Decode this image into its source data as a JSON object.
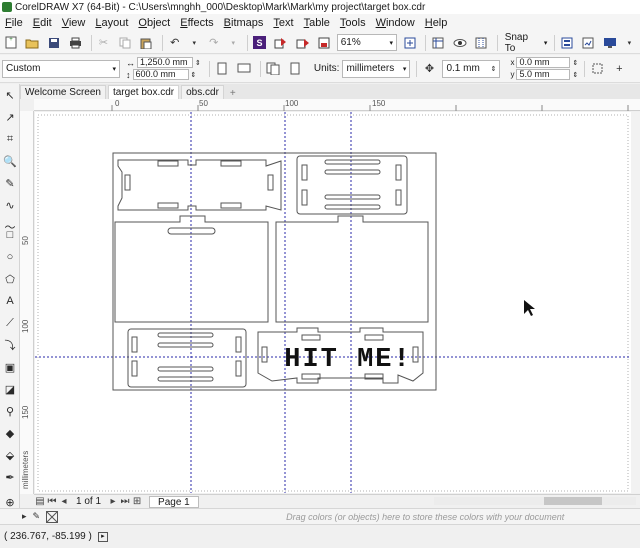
{
  "window": {
    "title": "CorelDRAW X7 (64-Bit) - C:\\Users\\mnghh_000\\Desktop\\Mark\\Mark\\my project\\target box.cdr"
  },
  "menu": {
    "items": [
      {
        "label": "File",
        "u": "F",
        "rest": "ile"
      },
      {
        "label": "Edit",
        "u": "E",
        "rest": "dit"
      },
      {
        "label": "View",
        "u": "V",
        "rest": "iew"
      },
      {
        "label": "Layout",
        "u": "L",
        "rest": "ayout"
      },
      {
        "label": "Object",
        "u": "O",
        "rest": "bject"
      },
      {
        "label": "Effects",
        "u": "E",
        "rest": "ffects",
        "prefix": ""
      },
      {
        "label": "Bitmaps",
        "u": "B",
        "rest": "itmaps"
      },
      {
        "label": "Text",
        "u": "T",
        "rest": "ext"
      },
      {
        "label": "Table",
        "u": "T",
        "rest": "able"
      },
      {
        "label": "Tools",
        "u": "T",
        "rest": "ools"
      },
      {
        "label": "Window",
        "u": "W",
        "rest": "indow"
      },
      {
        "label": "Help",
        "u": "H",
        "rest": "elp"
      }
    ]
  },
  "toolbar": {
    "zoom": "61%",
    "snap_label": "Snap To"
  },
  "property_bar": {
    "preset": "Custom",
    "width": "1,250.0 mm",
    "height": "600.0 mm",
    "units_label": "Units:",
    "units_value": "millimeters",
    "nudge": "0.1 mm",
    "dup_x": "0.0 mm",
    "dup_y": "5.0 mm"
  },
  "tabs": [
    {
      "label": "Welcome Screen",
      "active": false
    },
    {
      "label": "target box.cdr",
      "active": true
    },
    {
      "label": "obs.cdr",
      "active": false
    }
  ],
  "ruler": {
    "h_labels": [
      "0",
      "50",
      "100",
      "150"
    ],
    "v_labels": [
      "50",
      "100",
      "150"
    ],
    "v_units": "millimeters"
  },
  "canvas": {
    "artwork_text": "HIT ME!"
  },
  "pagebar": {
    "page_count": "1 of 1",
    "page_tab": "Page 1"
  },
  "colorbar": {
    "hint": "Drag colors (or objects) here to store these colors with your document"
  },
  "status": {
    "coords": "( 236.767, -85.199 )"
  },
  "colors": {
    "guide": "#2a2aa8",
    "outline": "#555555",
    "accent": "#4a1f7a"
  }
}
